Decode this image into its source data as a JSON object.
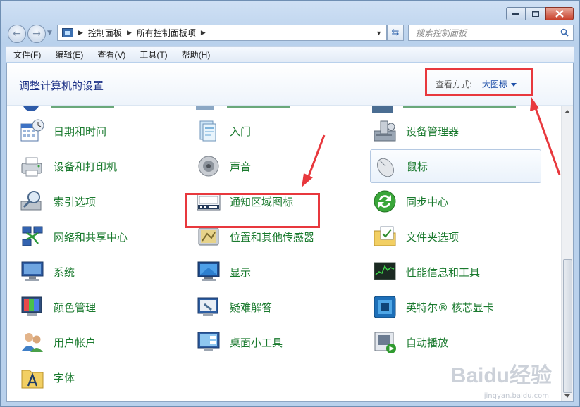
{
  "address_bar": {
    "crumbs": [
      "控制面板",
      "所有控制面板项"
    ]
  },
  "search": {
    "placeholder": "搜索控制面板"
  },
  "menu": [
    "文件(F)",
    "编辑(E)",
    "查看(V)",
    "工具(T)",
    "帮助(H)"
  ],
  "header": {
    "title": "调整计算机的设置",
    "view_by_label": "查看方式:",
    "view_by_value": "大图标"
  },
  "items": [
    {
      "label": "日期和时间",
      "icon": "calendar-clock-icon"
    },
    {
      "label": "入门",
      "icon": "getting-started-icon"
    },
    {
      "label": "设备管理器",
      "icon": "device-manager-icon"
    },
    {
      "label": "设备和打印机",
      "icon": "printer-icon"
    },
    {
      "label": "声音",
      "icon": "speaker-icon"
    },
    {
      "label": "鼠标",
      "icon": "mouse-icon"
    },
    {
      "label": "索引选项",
      "icon": "indexing-icon"
    },
    {
      "label": "通知区域图标",
      "icon": "notification-area-icon"
    },
    {
      "label": "同步中心",
      "icon": "sync-icon"
    },
    {
      "label": "网络和共享中心",
      "icon": "network-icon"
    },
    {
      "label": "位置和其他传感器",
      "icon": "location-sensor-icon"
    },
    {
      "label": "文件夹选项",
      "icon": "folder-options-icon"
    },
    {
      "label": "系统",
      "icon": "system-icon"
    },
    {
      "label": "显示",
      "icon": "display-icon"
    },
    {
      "label": "性能信息和工具",
      "icon": "performance-icon"
    },
    {
      "label": "颜色管理",
      "icon": "color-management-icon"
    },
    {
      "label": "疑难解答",
      "icon": "troubleshooting-icon"
    },
    {
      "label": "英特尔® 核芯显卡",
      "icon": "intel-graphics-icon"
    },
    {
      "label": "用户帐户",
      "icon": "user-accounts-icon"
    },
    {
      "label": "桌面小工具",
      "icon": "gadgets-icon"
    },
    {
      "label": "自动播放",
      "icon": "autoplay-icon"
    },
    {
      "label": "字体",
      "icon": "fonts-icon"
    }
  ],
  "selected_item": "鼠标",
  "watermark": {
    "brand": "Baidu经验",
    "url": "jingyan.baidu.com"
  },
  "colors": {
    "link_green": "#1a7a2e",
    "title_blue": "#1e3287",
    "highlight_red": "#e8383d"
  }
}
